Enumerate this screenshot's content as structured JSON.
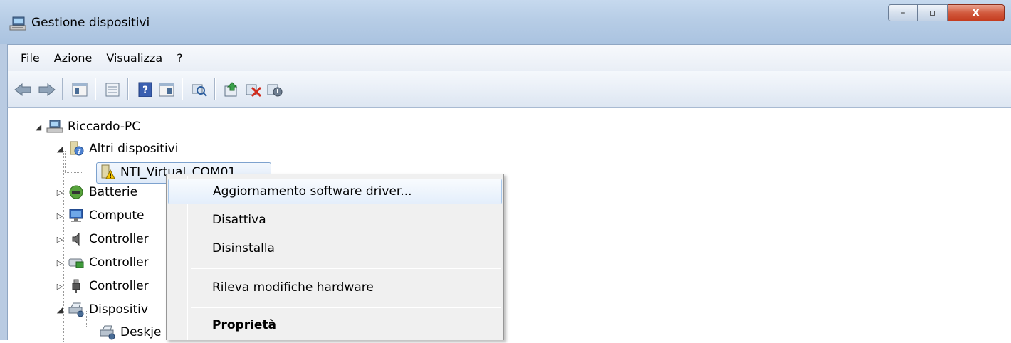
{
  "window": {
    "title": "Gestione dispositivi",
    "controls": {
      "minimize": "–",
      "maximize": "▫",
      "close": "X"
    }
  },
  "menubar": {
    "items": [
      "File",
      "Azione",
      "Visualizza",
      "?"
    ]
  },
  "toolbar": {
    "icons": [
      "back-icon",
      "forward-icon",
      "show-hide-console-tree-icon",
      "properties-icon",
      "help-icon",
      "show-action-pane-icon",
      "scan-hardware-icon",
      "update-driver-icon",
      "uninstall-icon",
      "disable-icon"
    ]
  },
  "tree": {
    "root": "Riccardo-PC",
    "nodes": [
      {
        "label": "Altri dispositivi",
        "expanded": true
      },
      {
        "label": "NTI_Virtual_COM01",
        "selected": true,
        "warning": true
      },
      {
        "label": "Batterie",
        "expanded": false
      },
      {
        "label": "Compute",
        "expanded": false
      },
      {
        "label": "Controller",
        "expanded": false
      },
      {
        "label": "Controller",
        "expanded": false
      },
      {
        "label": "Controller",
        "expanded": false
      },
      {
        "label": "Dispositiv",
        "expanded": true
      },
      {
        "label": "Deskje"
      }
    ]
  },
  "context_menu": {
    "items": [
      {
        "label": "Aggiornamento software driver...",
        "highlighted": true
      },
      {
        "label": "Disattiva"
      },
      {
        "label": "Disinstalla"
      },
      {
        "label": "Rileva modifiche hardware"
      },
      {
        "label": "Proprietà",
        "bold": true
      }
    ]
  },
  "colors": {
    "titlebar": "#b7cde6",
    "menu_hover_border": "#a8c8ec",
    "close_button": "#c43c1f"
  }
}
